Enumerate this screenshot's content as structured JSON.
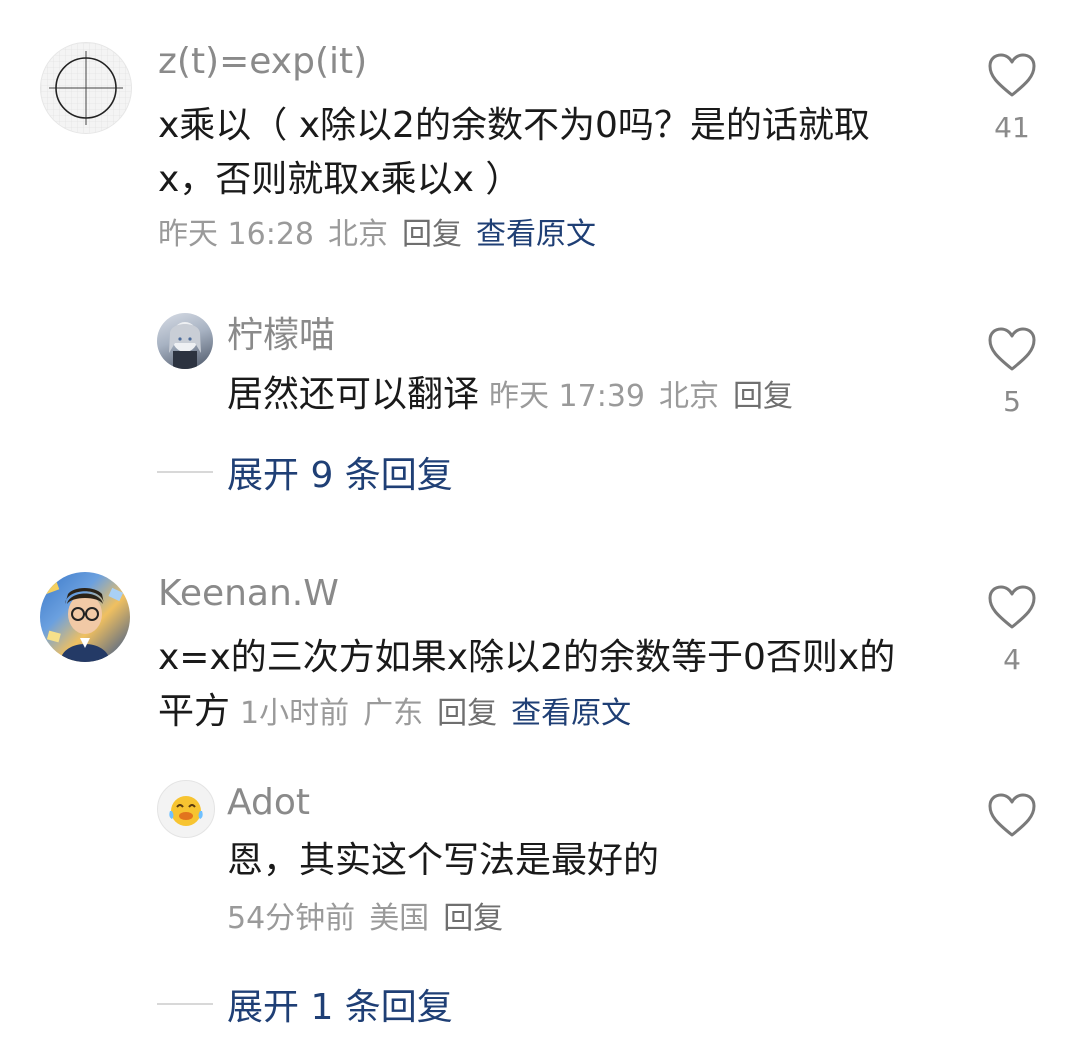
{
  "comments": [
    {
      "username": "z(t)=exp(it)",
      "content_lines": [
        "x乘以（ x除以2的余数不为0吗？是的话就取",
        "x，否则就取x乘以x ）"
      ],
      "time": "昨天 16:28",
      "location": "北京",
      "reply_label": "回复",
      "view_original_label": "查看原文",
      "like_count": "41",
      "avatar_icon": "graph-paper-circle-icon",
      "replies": [
        {
          "username": "柠檬喵",
          "content": "居然还可以翻译",
          "time": "昨天 17:39",
          "location": "北京",
          "reply_label": "回复",
          "like_count": "5",
          "avatar_icon": "anime-girl-avatar-icon"
        }
      ],
      "expand_label": "展开 9 条回复"
    },
    {
      "username": "Keenan.W",
      "content_lines": [
        "x=x的三次方如果x除以2的余数等于0否则x的",
        "平方"
      ],
      "time": "1小时前",
      "location": "广东",
      "reply_label": "回复",
      "view_original_label": "查看原文",
      "like_count": "4",
      "avatar_icon": "glasses-boy-avatar-icon",
      "replies": [
        {
          "username": "Adot",
          "content": "恩，其实这个写法是最好的",
          "time": "54分钟前",
          "location": "美国",
          "reply_label": "回复",
          "like_count": "",
          "avatar_icon": "crying-laughing-emoji-icon"
        }
      ],
      "expand_label": "展开 1 条回复"
    }
  ],
  "colors": {
    "username": "#8a8a8a",
    "text": "#1a1a1a",
    "meta": "#9a9a9a",
    "link": "#1f3f75",
    "heart_stroke": "#7a7a7a"
  }
}
